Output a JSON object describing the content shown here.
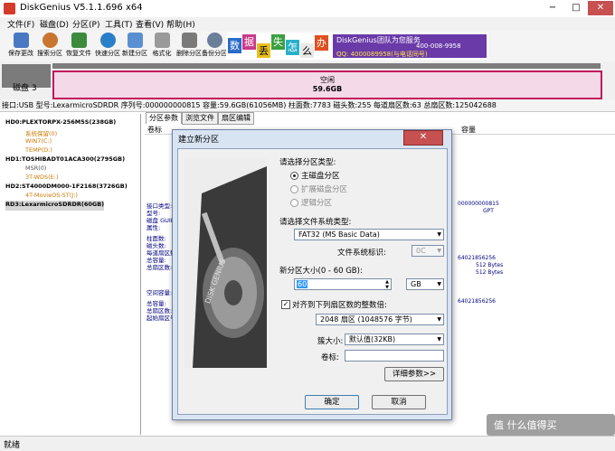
{
  "window": {
    "title": "DiskGenius V5.1.1.696 x64",
    "min": "−",
    "max": "□",
    "close": "✕"
  },
  "menu": [
    "文件(F)",
    "磁盘(D)",
    "分区(P)",
    "工具(T)",
    "查看(V)",
    "帮助(H)"
  ],
  "toolbar": [
    {
      "label": "保存更改",
      "icon": "save-icon",
      "color": "#4a78c2"
    },
    {
      "label": "搜索分区",
      "icon": "search-partition-icon",
      "color": "#c9742f"
    },
    {
      "label": "恢复文件",
      "icon": "recover-file-icon",
      "color": "#3c8a3c"
    },
    {
      "label": "快速分区",
      "icon": "quick-partition-icon",
      "color": "#2a7fc9"
    },
    {
      "label": "新建分区",
      "icon": "new-partition-icon",
      "color": "#5a8fd0"
    },
    {
      "label": "格式化",
      "icon": "format-icon",
      "color": "#8a8a8a"
    },
    {
      "label": "删除分区",
      "icon": "delete-partition-icon",
      "color": "#7a7a7a"
    },
    {
      "label": "备份分区",
      "icon": "backup-partition-icon",
      "color": "#6a7f9a"
    }
  ],
  "banner": {
    "chars": [
      "数",
      "据",
      "丢",
      "失",
      "怎",
      "么",
      "办"
    ],
    "line1": "DiskGenius团队为您服务",
    "line2": "400-008-9958",
    "line3": "QQ: 4000089958(与电话同号)"
  },
  "disk_label": "磁盘 3",
  "partition_bar": {
    "line1": "空闲",
    "line2": "59.6GB"
  },
  "disk_info": "接口:USB   型号:LexarmicroSDRDR   序列号:000000000815   容量:59.6GB(61056MB)   柱面数:7783   磁头数:255   每道扇区数:63   总扇区数:125042688",
  "tree": [
    {
      "text": "HD0:PLEXTORPX-256M5S(238GB)",
      "bold": true
    },
    {
      "text": "系统保留(0)",
      "color": "#c87a00"
    },
    {
      "text": "WIN7(C:)",
      "color": "#c87a00"
    },
    {
      "text": "TEMP(D:)",
      "color": "#c87a00"
    },
    {
      "text": "HD1:TOSHIBADT01ACA300(2795GB)",
      "bold": true
    },
    {
      "text": "MSR(0)",
      "color": "#555555"
    },
    {
      "text": "3T-WDS(E:)",
      "color": "#c87a00"
    },
    {
      "text": "HD2:ST4000DM000-1F2168(3726GB)",
      "bold": true
    },
    {
      "text": "4T-MovieOS-ST(J:)",
      "color": "#c87a00"
    },
    {
      "text": "RD3:LexarmicroSDRDR(60GB)",
      "bold": true
    }
  ],
  "tabs": [
    "分区参数",
    "浏览文件",
    "扇区编辑"
  ],
  "pane": {
    "col1": "卷标",
    "col2": "容量",
    "labels_a": [
      "接口类型:",
      "型号:",
      "磁盘 GUID:",
      "属性:"
    ],
    "labels_b": [
      "柱面数:",
      "磁头数:",
      "每道扇区数:",
      "总容量:",
      "总扇区数:"
    ],
    "labels_c": [
      "空间容量:"
    ],
    "labels_d": [
      "总容量:",
      "总扇区数:",
      "起始扇区号:"
    ],
    "vals_a": [
      "000000000815",
      "GPT"
    ],
    "vals_b": [
      "64021856256",
      "512 Bytes",
      "512 Bytes"
    ],
    "vals_c": [
      "64021856256"
    ]
  },
  "status": "就绪",
  "watermark": "值 什么值得买",
  "dialog": {
    "title": "建立新分区",
    "close": "✕",
    "type_label": "请选择分区类型:",
    "types": [
      "主磁盘分区",
      "扩展磁盘分区",
      "逻辑分区"
    ],
    "fs_label": "请选择文件系统类型:",
    "fs_value": "FAT32 (MS Basic Data)",
    "fs_id_label": "文件系统标识:",
    "fs_id_value": "0C",
    "size_label": "新分区大小(0 - 60 GB):",
    "size_value": "60",
    "size_unit": "GB",
    "align_label": "对齐到下列扇区数的整数倍:",
    "align_checked": true,
    "align_value": "2048 扇区 (1048576 字节)",
    "cluster_label": "簇大小:",
    "cluster_value": "默认值(32KB)",
    "volume_label": "卷标:",
    "volume_value": "",
    "detail_button": "详细参数>>",
    "ok_button": "确定",
    "cancel_button": "取消",
    "image_text": "DISK GENIUS"
  }
}
